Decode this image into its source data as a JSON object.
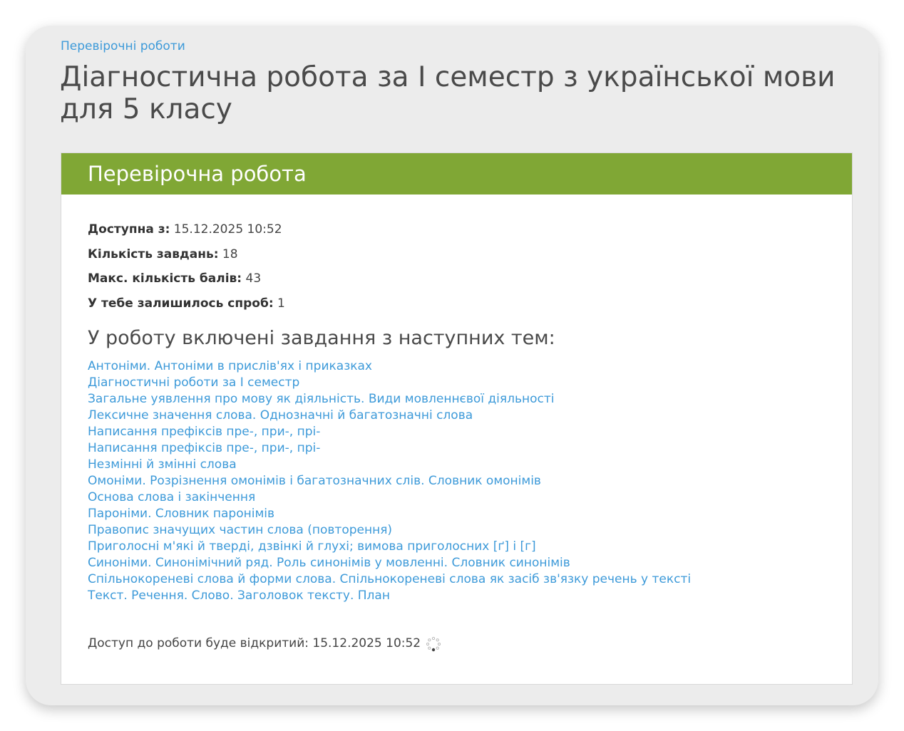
{
  "breadcrumb": "Перевірочні роботи",
  "page_title": "Діагностична робота за І семестр з української мови для 5 класу",
  "panel": {
    "title": "Перевірочна робота",
    "info": [
      {
        "label": "Доступна з:",
        "value": "15.12.2025 10:52"
      },
      {
        "label": "Кількість завдань:",
        "value": "18"
      },
      {
        "label": "Макс. кількість балів:",
        "value": "43"
      },
      {
        "label": "У тебе залишилось спроб:",
        "value": "1"
      }
    ],
    "topics_heading": "У роботу включені завдання з наступних тем:",
    "topics": [
      "Антоніми. Антоніми в прислів'ях і приказках",
      "Діагностичні роботи за І семестр",
      "Загальне уявлення про мову як діяльність. Види мовленнєвої діяльності",
      "Лексичне значення слова. Однозначні й багатозначні слова",
      "Написання префіксів пре-, при-, прі-",
      "Написання префіксів пре-, при-, прі-",
      "Незмінні й змінні слова",
      "Омоніми. Розрізнення омонімів і багатозначних слів. Словник омонімів",
      "Основа слова і закінчення",
      "Пароніми. Словник паронімів",
      "Правопис значущих частин слова (повторення)",
      "Приголосні м'які й тверді, дзвінкі й глухі; вимова приголосних [ґ] і [г]",
      "Синоніми. Синонімічний ряд. Роль синонімів у мовленні. Словник синонімів",
      "Спільнокореневі слова й форми слова. Спільнокореневі слова як засіб зв'язку речень у тексті",
      "Текст. Речення. Слово. Заголовок тексту. План"
    ],
    "access_text": "Доступ до роботи буде відкритий: 15.12.2025 10:52",
    "spinner_icon": "loading-spinner-icon"
  },
  "colors": {
    "header_green": "#80a735",
    "link_blue": "#3d9ad9",
    "card_bg": "#ececec"
  }
}
